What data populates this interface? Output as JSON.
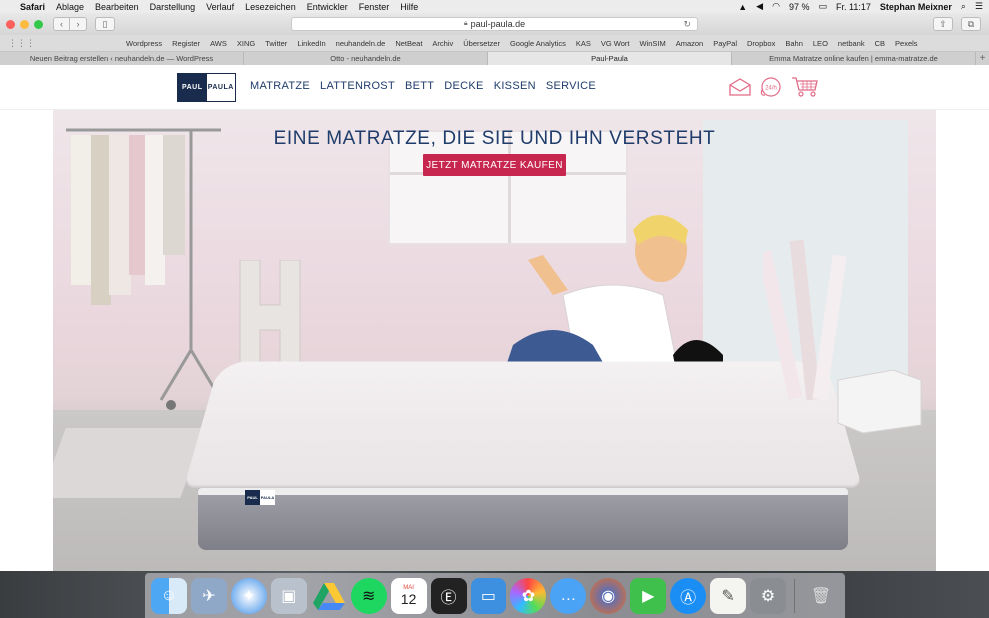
{
  "menubar": {
    "apple_icon": "apple-icon",
    "items": [
      "Safari",
      "Ablage",
      "Bearbeiten",
      "Darstellung",
      "Verlauf",
      "Lesezeichen",
      "Entwickler",
      "Fenster",
      "Hilfe"
    ],
    "battery": "97 %",
    "time": "Fr. 11:17",
    "user": "Stephan Meixner"
  },
  "toolbar": {
    "url": "paul-paula.de"
  },
  "favorites": [
    "Wordpress",
    "Register",
    "AWS",
    "XING",
    "Twitter",
    "LinkedIn",
    "neuhandeln.de",
    "NetBeat",
    "Archiv",
    "Übersetzer",
    "Google Analytics",
    "KAS",
    "VG Wort",
    "WinSIM",
    "Amazon",
    "PayPal",
    "Dropbox",
    "Bahn",
    "LEO",
    "netbank",
    "CB",
    "Pexels"
  ],
  "tabs": [
    {
      "label": "Neuen Beitrag erstellen ‹ neuhandeln.de — WordPress",
      "active": false
    },
    {
      "label": "Otto - neuhandeln.de",
      "active": false
    },
    {
      "label": "Paul-Paula",
      "active": true
    },
    {
      "label": "Emma Matratze online kaufen | emma-matratze.de",
      "active": false
    }
  ],
  "site": {
    "logo_left": "PAUL",
    "logo_right": "PAULA",
    "nav": [
      "MATRATZE",
      "LATTENROST",
      "BETT",
      "DECKE",
      "KISSEN",
      "SERVICE"
    ],
    "hero_title": "EINE MATRATZE, DIE SIE UND IHN VERSTEHT",
    "cta": "JETZT MATRATZE KAUFEN",
    "accent": "#c7264e",
    "brand": "#1a2c4e",
    "nav_color": "#1f3c6b",
    "mattress_label_left": "PAUL",
    "mattress_label_right": "PAULA",
    "phone_icon_text": "24/h"
  },
  "dock": {
    "calendar_month": "MAI",
    "calendar_day": "12"
  }
}
